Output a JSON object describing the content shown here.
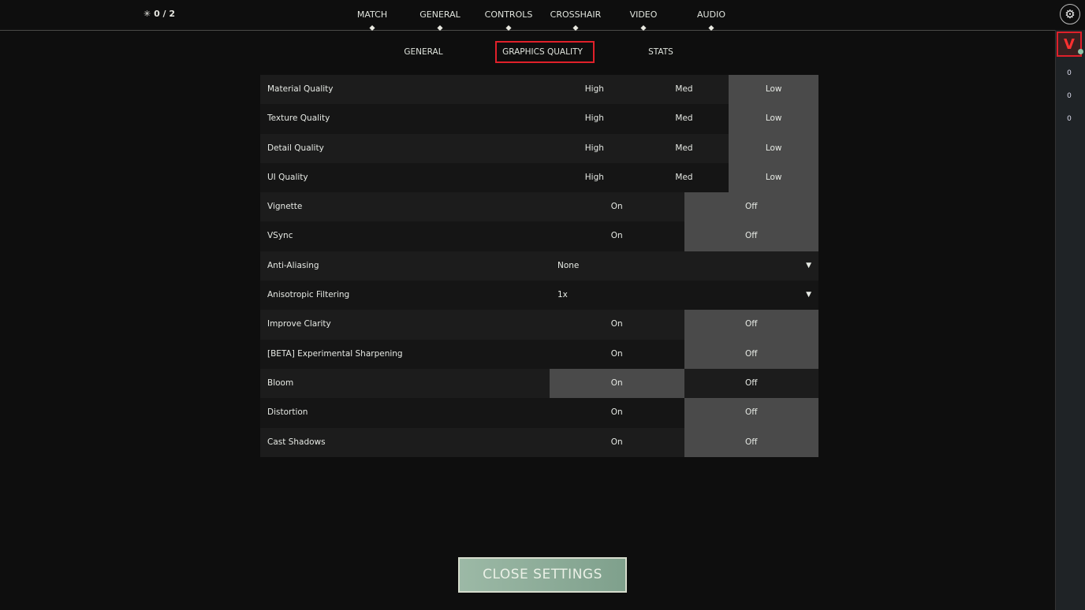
{
  "header": {
    "counter": "0 / 2",
    "counter_icon": "spark-icon"
  },
  "tabs": [
    {
      "label": "MATCH"
    },
    {
      "label": "GENERAL"
    },
    {
      "label": "CONTROLS"
    },
    {
      "label": "CROSSHAIR"
    },
    {
      "label": "VIDEO",
      "active": true
    },
    {
      "label": "AUDIO"
    }
  ],
  "subtabs": [
    {
      "label": "GENERAL"
    },
    {
      "label": "GRAPHICS QUALITY",
      "active": true
    },
    {
      "label": "STATS"
    }
  ],
  "side": {
    "scores": [
      "0",
      "0",
      "0"
    ],
    "highlight_color": "#e0202a"
  },
  "settings": [
    {
      "label": "Material Quality",
      "options": [
        "High",
        "Med",
        "Low"
      ],
      "selected": 2
    },
    {
      "label": "Texture Quality",
      "options": [
        "High",
        "Med",
        "Low"
      ],
      "selected": 2
    },
    {
      "label": "Detail Quality",
      "options": [
        "High",
        "Med",
        "Low"
      ],
      "selected": 2
    },
    {
      "label": "UI Quality",
      "options": [
        "High",
        "Med",
        "Low"
      ],
      "selected": 2
    },
    {
      "label": "Vignette",
      "options": [
        "On",
        "Off"
      ],
      "selected": 1
    },
    {
      "label": "VSync",
      "options": [
        "On",
        "Off"
      ],
      "selected": 1
    },
    {
      "label": "Anti-Aliasing",
      "dropdown": "None"
    },
    {
      "label": "Anisotropic Filtering",
      "dropdown": "1x"
    },
    {
      "label": "Improve Clarity",
      "options": [
        "On",
        "Off"
      ],
      "selected": 1
    },
    {
      "label": "[BETA] Experimental Sharpening",
      "options": [
        "On",
        "Off"
      ],
      "selected": 1
    },
    {
      "label": "Bloom",
      "options": [
        "On",
        "Off"
      ],
      "selected": 0
    },
    {
      "label": "Distortion",
      "options": [
        "On",
        "Off"
      ],
      "selected": 1
    },
    {
      "label": "Cast Shadows",
      "options": [
        "On",
        "Off"
      ],
      "selected": 1
    }
  ],
  "close_button": "CLOSE SETTINGS"
}
